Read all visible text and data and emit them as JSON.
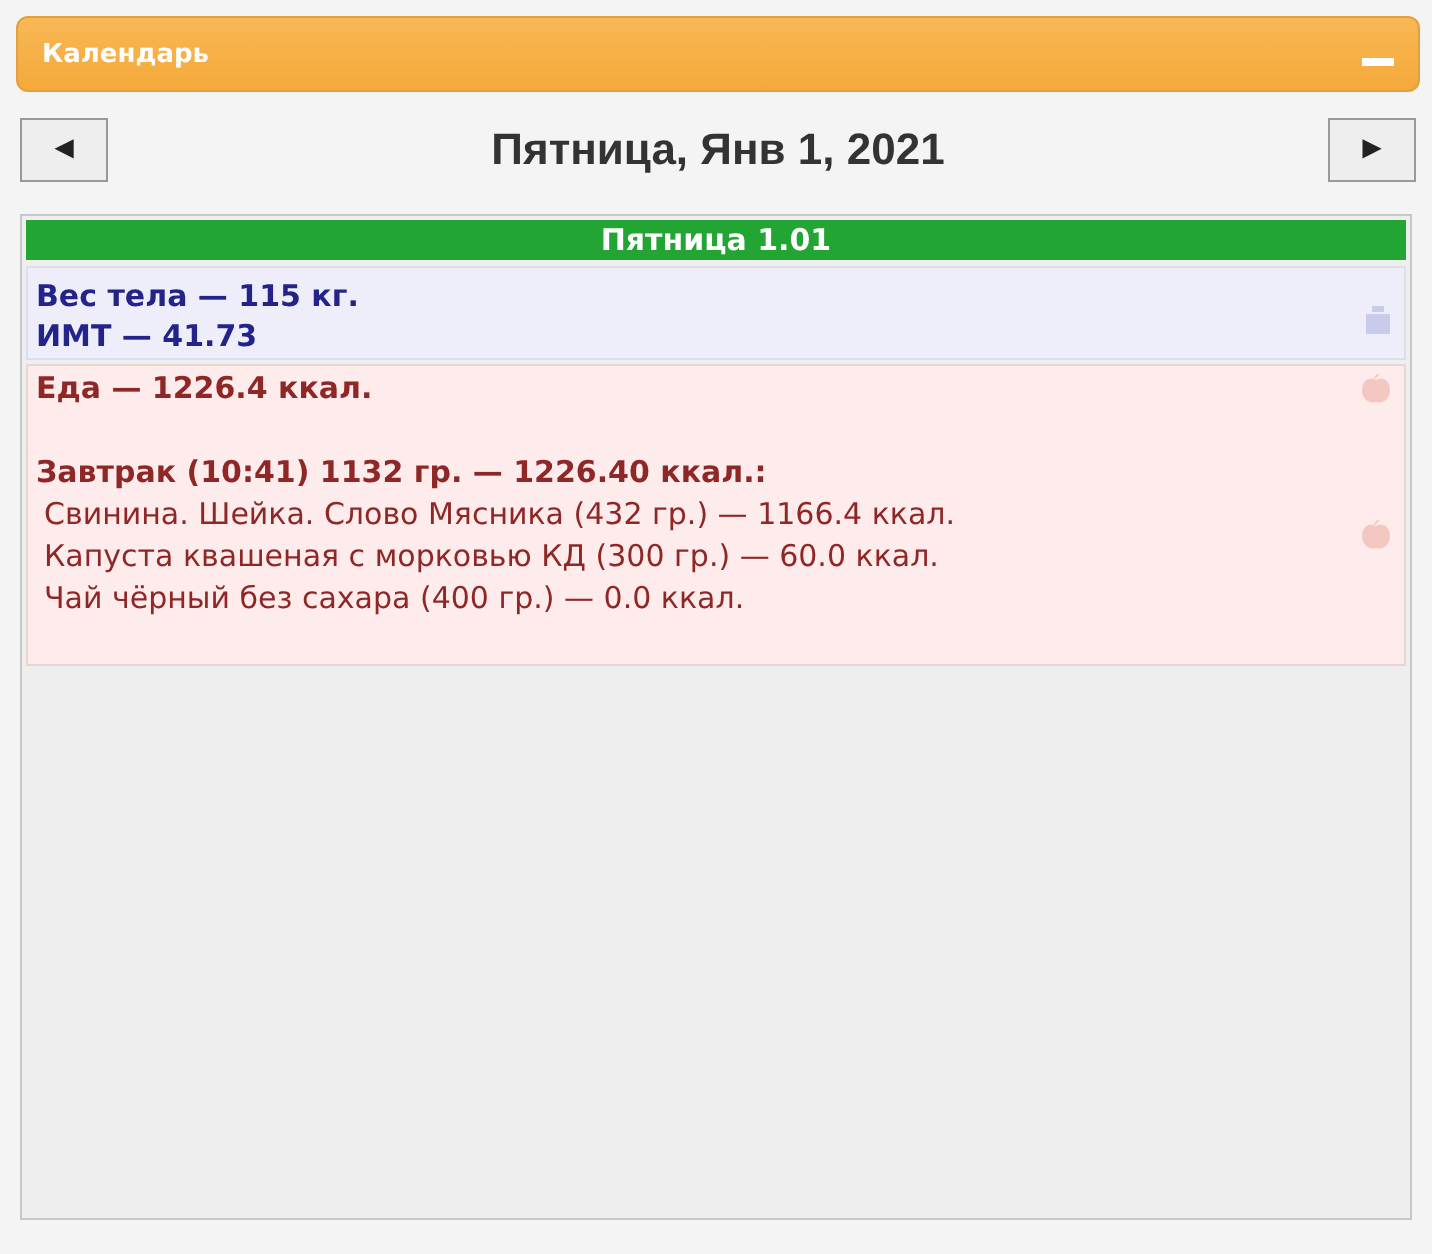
{
  "header": {
    "title": "Календарь"
  },
  "nav": {
    "prev": "◄",
    "date": "Пятница, Янв 1, 2021",
    "next": "►"
  },
  "day": {
    "title": "Пятница 1.01",
    "weight": {
      "lines": [
        "Вес тела — 115 кг.",
        "ИМТ — 41.73"
      ]
    },
    "food": {
      "total": "Еда — 1226.4 ккал.",
      "meals": [
        {
          "title": "Завтрак (10:41) 1132 гр. — 1226.40 ккал.:",
          "items": [
            "Свинина. Шейка. Слово Мясника (432 гр.) — 1166.4 ккал.",
            "Капуста квашеная с морковью КД (300 гр.) — 60.0 ккал.",
            "Чай чёрный без сахара (400 гр.) — 0.0 ккал."
          ]
        }
      ]
    }
  }
}
